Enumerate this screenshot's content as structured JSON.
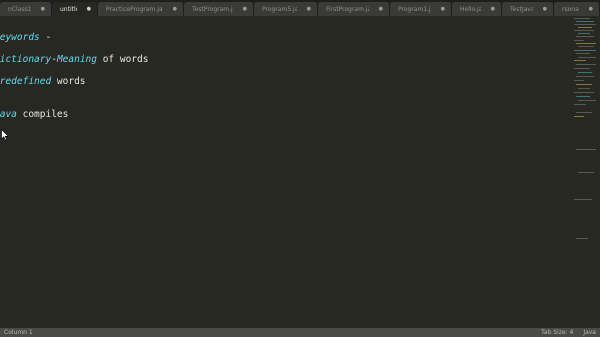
{
  "tabs": [
    {
      "label": "nClass1.java",
      "active": false
    },
    {
      "label": "untitled",
      "active": true
    },
    {
      "label": "PracticeProgram.java",
      "active": false
    },
    {
      "label": "TestProgram.java",
      "active": false
    },
    {
      "label": "Program5.java",
      "active": false
    },
    {
      "label": "FirstProgram.java",
      "active": false
    },
    {
      "label": "Program1.java",
      "active": false
    },
    {
      "label": "Hello.java",
      "active": false
    },
    {
      "label": "TestJava.java",
      "active": false
    },
    {
      "label": "rsonation.java",
      "active": false
    }
  ],
  "tab_close_glyph": "●",
  "editor": {
    "line1": {
      "kw": "Keywords",
      "rest": " -"
    },
    "line2": {
      "kw": "Dictionary",
      "rest1": "-",
      "kw2": "Meaning",
      "rest2": " of words"
    },
    "line3": {
      "kw": "Predefined",
      "rest": " words"
    },
    "line4": {
      "kw": "Java",
      "rest": " compiles"
    }
  },
  "status": {
    "position": "Column 1",
    "tab_size": "Tab Size: 4",
    "syntax": "Java"
  },
  "colors": {
    "background": "#272822",
    "keyword": "#66d9ef",
    "text": "#e8e8e2"
  }
}
